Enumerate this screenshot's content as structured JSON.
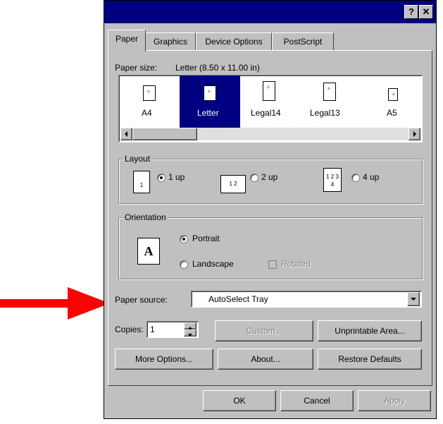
{
  "window": {
    "title": "",
    "help_glyph": "?",
    "close_glyph": "✕"
  },
  "tabs": [
    {
      "label": "Paper"
    },
    {
      "label": "Graphics"
    },
    {
      "label": "Device Options"
    },
    {
      "label": "PostScript"
    }
  ],
  "paper_size": {
    "label": "Paper size:",
    "value": "Letter (8.50 x 11.00 in)",
    "items": [
      "A4",
      "Letter",
      "Legal14",
      "Legal13",
      "A5"
    ],
    "selected": "Letter"
  },
  "layout": {
    "legend": "Layout",
    "options": [
      {
        "label": "1 up",
        "icon_text": "1",
        "selected": true
      },
      {
        "label": "2 up",
        "icon_text": "1 2",
        "selected": false
      },
      {
        "label": "4 up",
        "icon_text": "1 2 3 4",
        "selected": false
      }
    ]
  },
  "orientation": {
    "legend": "Orientation",
    "icon_letter": "A",
    "portrait": "Portrait",
    "landscape": "Landscape",
    "rotated": "Rotated",
    "selected": "Portrait"
  },
  "paper_source": {
    "label": "Paper source:",
    "value": "AutoSelect Tray"
  },
  "copies": {
    "label": "Copies:",
    "value": "1"
  },
  "buttons": {
    "custom": "Custom...",
    "unprintable": "Unprintable Area...",
    "more_options": "More Options...",
    "about": "About...",
    "restore_defaults": "Restore Defaults",
    "ok": "OK",
    "cancel": "Cancel",
    "apply": "Apply"
  },
  "colors": {
    "titlebar": "#000080",
    "face": "#c0c0c0",
    "arrow": "#ff0000",
    "selection": "#000080"
  }
}
